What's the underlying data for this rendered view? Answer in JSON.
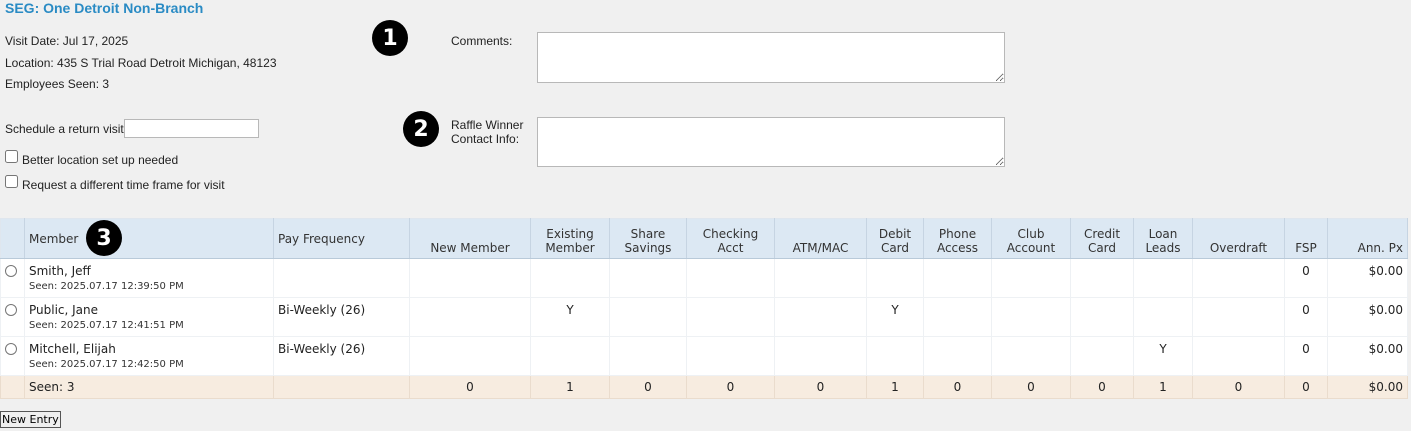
{
  "page_title": "SEG: One Detroit Non-Branch",
  "visit": {
    "date_label": "Visit Date: Jul 17, 2025",
    "location_label": "Location: 435 S Trial Road Detroit Michigan, 48123",
    "employees_label": "Employees Seen: 3"
  },
  "badges": [
    "1",
    "2",
    "3"
  ],
  "comments": {
    "label": "Comments:",
    "value": ""
  },
  "raffle": {
    "label_line1": "Raffle Winner",
    "label_line2": "Contact Info:",
    "value": ""
  },
  "return_visit": {
    "label": "Schedule a return visit:",
    "value": ""
  },
  "checkboxes": {
    "better_location": {
      "label": "Better location set up needed",
      "checked": false
    },
    "different_time": {
      "label": "Request a different time frame for visit",
      "checked": false
    }
  },
  "table": {
    "headers": {
      "member": "Member",
      "pay_frequency": "Pay Frequency",
      "new_member": "New Member",
      "existing_member": [
        "Existing",
        "Member"
      ],
      "share_savings": [
        "Share",
        "Savings"
      ],
      "checking_acct": [
        "Checking",
        "Acct"
      ],
      "atm_mac": "ATM/MAC",
      "debit_card": [
        "Debit",
        "Card"
      ],
      "phone_access": [
        "Phone",
        "Access"
      ],
      "club_account": [
        "Club",
        "Account"
      ],
      "credit_card": [
        "Credit",
        "Card"
      ],
      "loan_leads": [
        "Loan",
        "Leads"
      ],
      "overdraft": "Overdraft",
      "fsp": "FSP",
      "ann_px": "Ann. Px"
    },
    "rows": [
      {
        "name": "Smith, Jeff",
        "seen": "Seen: 2025.07.17 12:39:50 PM",
        "pay_frequency": "",
        "new_member": "",
        "existing_member": "",
        "share_savings": "",
        "checking_acct": "",
        "atm_mac": "",
        "debit_card": "",
        "phone_access": "",
        "club_account": "",
        "credit_card": "",
        "loan_leads": "",
        "overdraft": "",
        "fsp": "0",
        "ann_px": "$0.00"
      },
      {
        "name": "Public, Jane",
        "seen": "Seen: 2025.07.17 12:41:51 PM",
        "pay_frequency": "Bi-Weekly (26)",
        "new_member": "",
        "existing_member": "Y",
        "share_savings": "",
        "checking_acct": "",
        "atm_mac": "",
        "debit_card": "Y",
        "phone_access": "",
        "club_account": "",
        "credit_card": "",
        "loan_leads": "",
        "overdraft": "",
        "fsp": "0",
        "ann_px": "$0.00"
      },
      {
        "name": "Mitchell, Elijah",
        "seen": "Seen: 2025.07.17 12:42:50 PM",
        "pay_frequency": "Bi-Weekly (26)",
        "new_member": "",
        "existing_member": "",
        "share_savings": "",
        "checking_acct": "",
        "atm_mac": "",
        "debit_card": "",
        "phone_access": "",
        "club_account": "",
        "credit_card": "",
        "loan_leads": "Y",
        "overdraft": "",
        "fsp": "0",
        "ann_px": "$0.00"
      }
    ],
    "totals": {
      "seen": "Seen: 3",
      "pay_frequency": "",
      "new_member": "0",
      "existing_member": "1",
      "share_savings": "0",
      "checking_acct": "0",
      "atm_mac": "0",
      "debit_card": "1",
      "phone_access": "0",
      "club_account": "0",
      "credit_card": "0",
      "loan_leads": "1",
      "overdraft": "0",
      "fsp": "0",
      "ann_px": "$0.00"
    }
  },
  "new_entry_label": "New Entry"
}
